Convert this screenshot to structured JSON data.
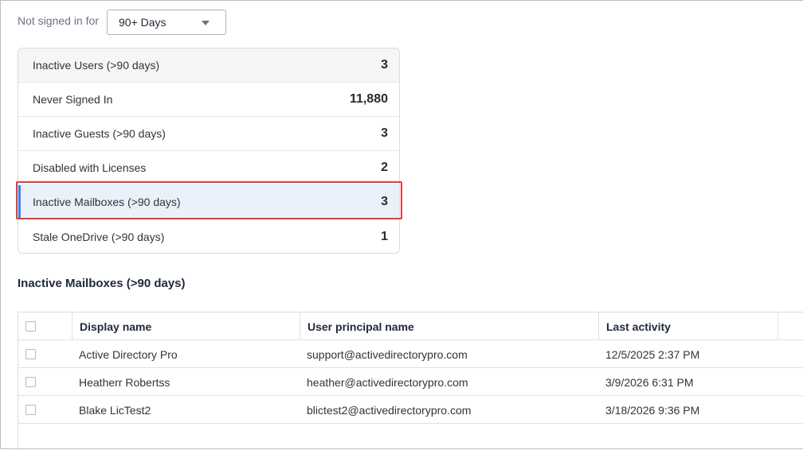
{
  "filter": {
    "label": "Not signed in for",
    "selected": "90+ Days"
  },
  "summary": [
    {
      "label": "Inactive Users (>90 days)",
      "count": "3"
    },
    {
      "label": "Never Signed In",
      "count": "11,880"
    },
    {
      "label": "Inactive Guests (>90 days)",
      "count": "3"
    },
    {
      "label": "Disabled with Licenses",
      "count": "2"
    },
    {
      "label": "Inactive Mailboxes (>90 days)",
      "count": "3"
    },
    {
      "label": "Stale OneDrive (>90 days)",
      "count": "1"
    }
  ],
  "section": {
    "title": "Inactive Mailboxes (>90 days)"
  },
  "table": {
    "columns": [
      "Display name",
      "User principal name",
      "Last activity"
    ],
    "rows": [
      {
        "name": "Active Directory Pro",
        "upn": "support@activedirectorypro.com",
        "last": "12/5/2025 2:37 PM"
      },
      {
        "name": "Heatherr Robertss",
        "upn": "heather@activedirectorypro.com",
        "last": "3/9/2026 6:31 PM"
      },
      {
        "name": "Blake LicTest2",
        "upn": "blictest2@activedirectorypro.com",
        "last": "3/18/2026 9:36 PM"
      }
    ]
  },
  "colors": {
    "selected_bg": "#eaf1fb",
    "selected_accent": "#3b82f6",
    "highlight_border": "#e03d3d"
  }
}
